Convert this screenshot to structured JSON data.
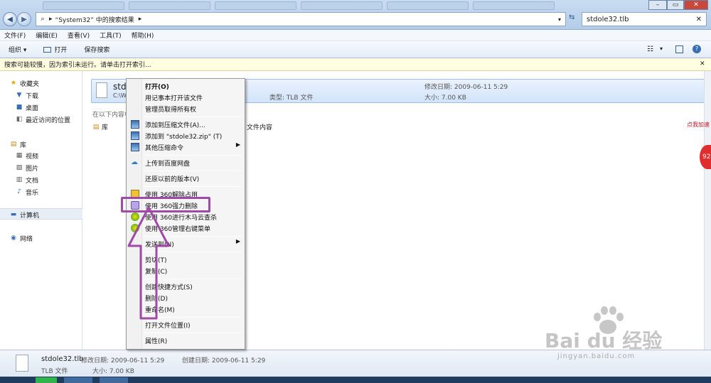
{
  "titlebar": {
    "address": "“System32” 中的搜索结果",
    "search_value": "stdole32.tlb"
  },
  "menu": [
    "文件(F)",
    "编辑(E)",
    "查看(V)",
    "工具(T)",
    "帮助(H)"
  ],
  "toolbar": {
    "organize": "组织 ▾",
    "open": "打开",
    "save_search": "保存搜索"
  },
  "infobar": {
    "text": "搜索可能较慢，因为索引未运行。请单击打开索引..."
  },
  "sidebar": {
    "favorites": "收藏夹",
    "downloads": "下载",
    "desktop": "桌面",
    "recent": "最近访问的位置",
    "libraries": "库",
    "videos": "视频",
    "pictures": "图片",
    "documents": "文档",
    "music": "音乐",
    "computer": "计算机",
    "network": "网络"
  },
  "file": {
    "name": "stdole32.tlb",
    "path_short": "C:\\W",
    "type": "类型: TLB 文件",
    "modified": "修改日期: 2009-06-11 5:29",
    "size": "大小: 7.00 KB",
    "name_visible": "stdole",
    "search_again_label": "在以下内容中",
    "lib_label": "库",
    "file_content_label": "文件内容"
  },
  "context_menu": [
    {
      "label": "打开(O)",
      "bold": true
    },
    {
      "label": "用记事本打开该文件"
    },
    {
      "label": "管理员取得所有权"
    },
    {
      "label": "添加到压缩文件(A)..."
    },
    {
      "label": "添加到 \"stdole32.zip\" (T)"
    },
    {
      "label": "其他压缩命令",
      "submenu": true
    },
    {
      "label": "上传到百度网盘"
    },
    {
      "label": "还原以前的版本(V)"
    },
    {
      "label": "使用 360解除占用"
    },
    {
      "label": "使用 360强力删除"
    },
    {
      "label": "使用 360进行木马云查杀"
    },
    {
      "label": "使用 360管理右键菜单"
    },
    {
      "label": "发送到(N)",
      "submenu": true
    },
    {
      "label": "剪切(T)"
    },
    {
      "label": "复制(C)"
    },
    {
      "label": "创建快捷方式(S)"
    },
    {
      "label": "删除(D)"
    },
    {
      "label": "重命名(M)"
    },
    {
      "label": "打开文件位置(I)"
    },
    {
      "label": "属性(R)"
    }
  ],
  "details": {
    "name": "stdole32.tlb",
    "type": "TLB 文件",
    "modified": "修改日期: 2009-06-11 5:29",
    "size": "大小: 7.00 KB",
    "created": "创建日期: 2009-06-11 5:29"
  },
  "side_ad": {
    "text": "点我加速",
    "badge": "92"
  },
  "watermark": {
    "brand": "Bai du 经验",
    "url": "jingyan.baidu.com"
  },
  "colors": {
    "highlight": "#a04aa8",
    "selection": "#d2e4fa"
  }
}
